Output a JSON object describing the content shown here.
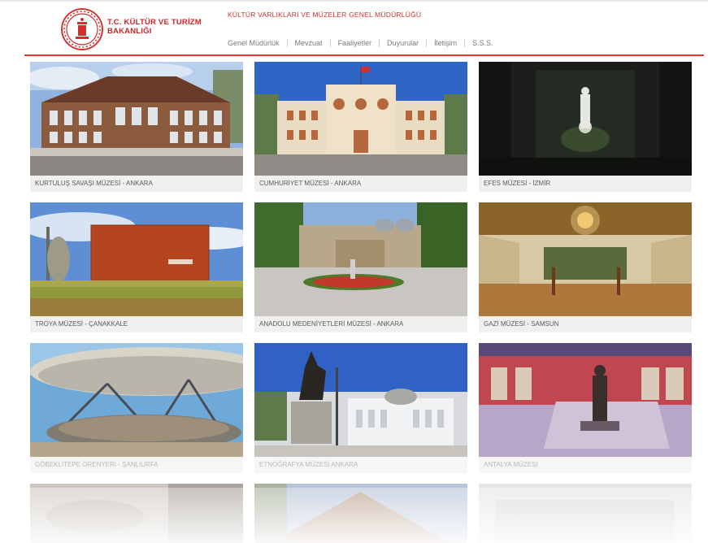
{
  "header": {
    "ministry_line1": "T.C. KÜLTÜR VE TURİZM",
    "ministry_line2": "BAKANLIĞI",
    "department": "KÜLTÜR VARLIKLARI VE MÜZELER GENEL MÜDÜRLÜĞÜ",
    "nav": [
      "Genel Müdürlük",
      "Mevzuat",
      "Faaliyetler",
      "Duyurular",
      "İletişim",
      "S.S.S."
    ]
  },
  "museums": [
    {
      "name": "KURTULUŞ SAVAŞI MÜZESİ - ANKARA"
    },
    {
      "name": "CUMHURİYET MÜZESİ - ANKARA"
    },
    {
      "name": "EFES MÜZESİ - İZMİR"
    },
    {
      "name": "TROYA MÜZESİ - ÇANAKKALE"
    },
    {
      "name": "ANADOLU MEDENİYETLERİ MÜZESİ - ANKARA"
    },
    {
      "name": "GAZİ MÜZESİ - SAMSUN"
    },
    {
      "name": "GÖBEKLİTEPE ÖRENYERİ - ŞANLIURFA"
    },
    {
      "name": "ETNOĞRAFYA MÜZESİ ANKARA"
    },
    {
      "name": "ANTALYA MÜZESİ"
    }
  ],
  "colors": {
    "brand_red": "#d32f2f"
  }
}
